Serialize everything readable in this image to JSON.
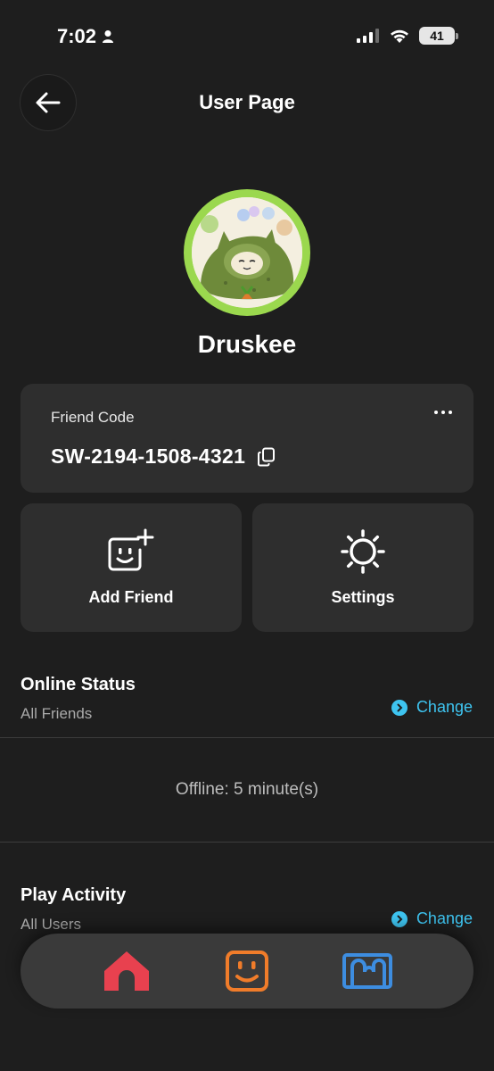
{
  "status_bar": {
    "time": "7:02",
    "battery": "41"
  },
  "header": {
    "title": "User Page"
  },
  "profile": {
    "username": "Druskee"
  },
  "friend_code": {
    "label": "Friend Code",
    "code": "SW-2194-1508-4321"
  },
  "actions": [
    {
      "label": "Add Friend",
      "icon": "add-friend-icon"
    },
    {
      "label": "Settings",
      "icon": "gear-icon"
    }
  ],
  "online_status": {
    "title": "Online Status",
    "value": "All Friends",
    "change_label": "Change",
    "offline_text": "Offline: 5 minute(s)"
  },
  "play_activity": {
    "title": "Play Activity",
    "value": "All Users",
    "change_label": "Change"
  },
  "bottom_nav": [
    {
      "icon": "home-icon",
      "color": "#e8414f"
    },
    {
      "icon": "friends-icon",
      "color": "#f07c2a"
    },
    {
      "icon": "news-icon",
      "color": "#3d8de0"
    }
  ],
  "colors": {
    "accent": "#3ec4f0",
    "background": "#1e1e1e",
    "card": "#2e2e2e"
  }
}
